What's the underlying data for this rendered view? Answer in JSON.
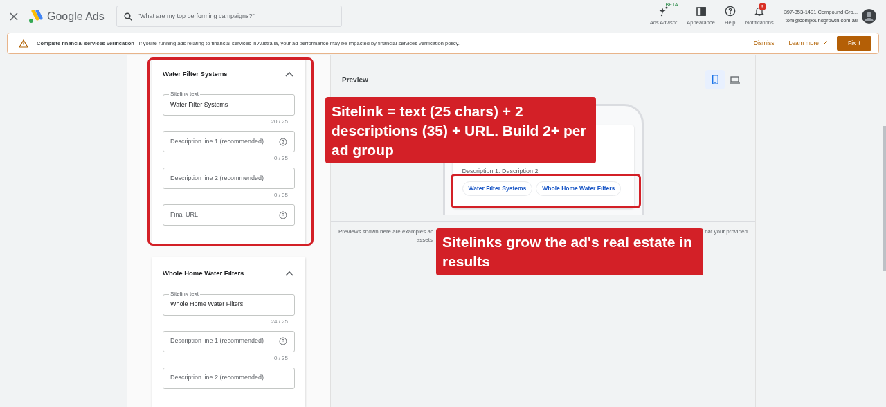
{
  "header": {
    "product": "Google Ads",
    "search": {
      "placeholder": "\"What are my top performing campaigns?\""
    },
    "actions": [
      {
        "kind": "advisor",
        "label": "Ads Advisor",
        "badge": "BETA"
      },
      {
        "kind": "appearance",
        "label": "Appearance"
      },
      {
        "kind": "help",
        "label": "Help"
      },
      {
        "kind": "notifications",
        "label": "Notifications",
        "badge": "!"
      }
    ],
    "account": {
      "name": "397-853-1491 Compound Gro...",
      "email": "tom@compoundgrowth.com.au"
    }
  },
  "banner": {
    "title": "Complete financial services verification",
    "message": " - If you're running ads relating to financial services in Australia, your ad performance may be impacted by financial services verification policy.",
    "dismiss": "Dismiss",
    "learn_more": "Learn more",
    "fix": "Fix it"
  },
  "sitelinks": [
    {
      "title": "Water Filter Systems",
      "expanded": true,
      "fields": [
        {
          "kind": "text",
          "label": "Sitelink text",
          "value": "Water Filter Systems",
          "counter": "20 / 25"
        },
        {
          "kind": "help",
          "placeholder": "Description line 1 (recommended)",
          "counter": "0 / 35"
        },
        {
          "kind": "plain",
          "placeholder": "Description line 2 (recommended)",
          "counter": "0 / 35"
        },
        {
          "kind": "help",
          "placeholder": "Final URL"
        }
      ]
    },
    {
      "title": "Whole Home Water Filters",
      "expanded": true,
      "fields": [
        {
          "kind": "text",
          "label": "Sitelink text",
          "value": "Whole Home Water Filters",
          "counter": "24 / 25"
        },
        {
          "kind": "help",
          "placeholder": "Description line 1 (recommended)",
          "counter": "0 / 35"
        },
        {
          "kind": "plain",
          "placeholder": "Description line 2 (recommended)"
        }
      ]
    }
  ],
  "preview": {
    "title": "Preview",
    "devices": [
      {
        "kind": "mobile",
        "selected": true
      },
      {
        "kind": "desktop",
        "selected": false
      }
    ],
    "description": "Description 1. Description 2",
    "chips": [
      "Water Filter Systems",
      "Whole Home Water Filters"
    ],
    "caption_left": "Previews shown here are examples ac",
    "caption_right": "hat your provided",
    "caption_second": "assets"
  },
  "annotations": [
    "Sitelink = text (25 chars) + 2 descriptions (35) + URL. Build 2+ per ad group",
    "Sitelinks grow the ad's real estate in results"
  ]
}
